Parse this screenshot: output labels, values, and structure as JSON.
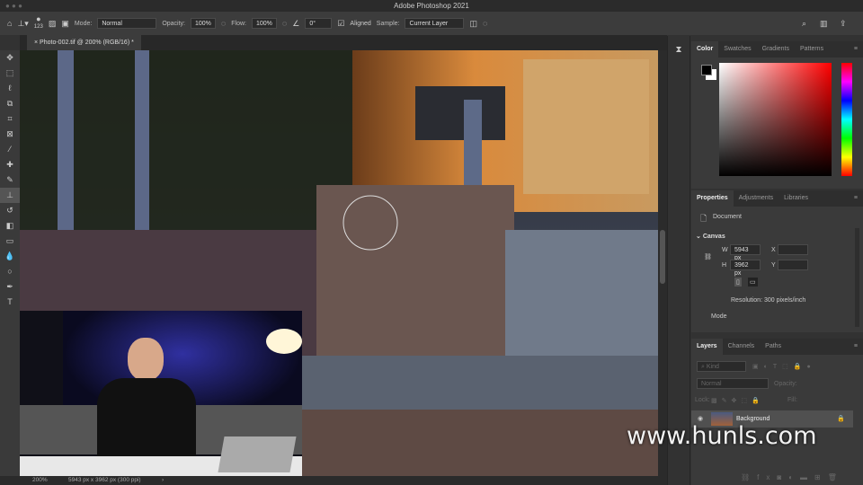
{
  "app_title": "Adobe Photoshop 2021",
  "options": {
    "brush_size": "123",
    "mode_label": "Mode:",
    "mode_value": "Normal",
    "opacity_label": "Opacity:",
    "opacity_value": "100%",
    "flow_label": "Flow:",
    "flow_value": "100%",
    "angle_value": "0°",
    "aligned_label": "Aligned",
    "sample_label": "Sample:",
    "sample_value": "Current Layer"
  },
  "document_tab": "Photo-002.tif @ 200% (RGB/16) *",
  "status": {
    "zoom": "200%",
    "doc_info": "5943 px x 3962 px (300 ppi)"
  },
  "color_panel": {
    "tabs": [
      "Color",
      "Swatches",
      "Gradients",
      "Patterns"
    ]
  },
  "properties_panel": {
    "tabs": [
      "Properties",
      "Adjustments",
      "Libraries"
    ],
    "document_label": "Document",
    "canvas_label": "Canvas",
    "w_label": "W",
    "w_value": "5943 px",
    "h_label": "H",
    "h_value": "3962 px",
    "x_label": "X",
    "y_label": "Y",
    "resolution": "Resolution: 300 pixels/inch",
    "mode_label": "Mode"
  },
  "layers_panel": {
    "tabs": [
      "Layers",
      "Channels",
      "Paths"
    ],
    "kind_placeholder": "Kind",
    "blend_mode": "Normal",
    "opacity_label": "Opacity:",
    "lock_label": "Lock:",
    "fill_label": "Fill:",
    "layers": [
      {
        "name": "Background"
      }
    ]
  },
  "watermark": "www.hunls.com",
  "colors": {
    "accent": "#ff0000",
    "panel": "#3a3a3a"
  }
}
